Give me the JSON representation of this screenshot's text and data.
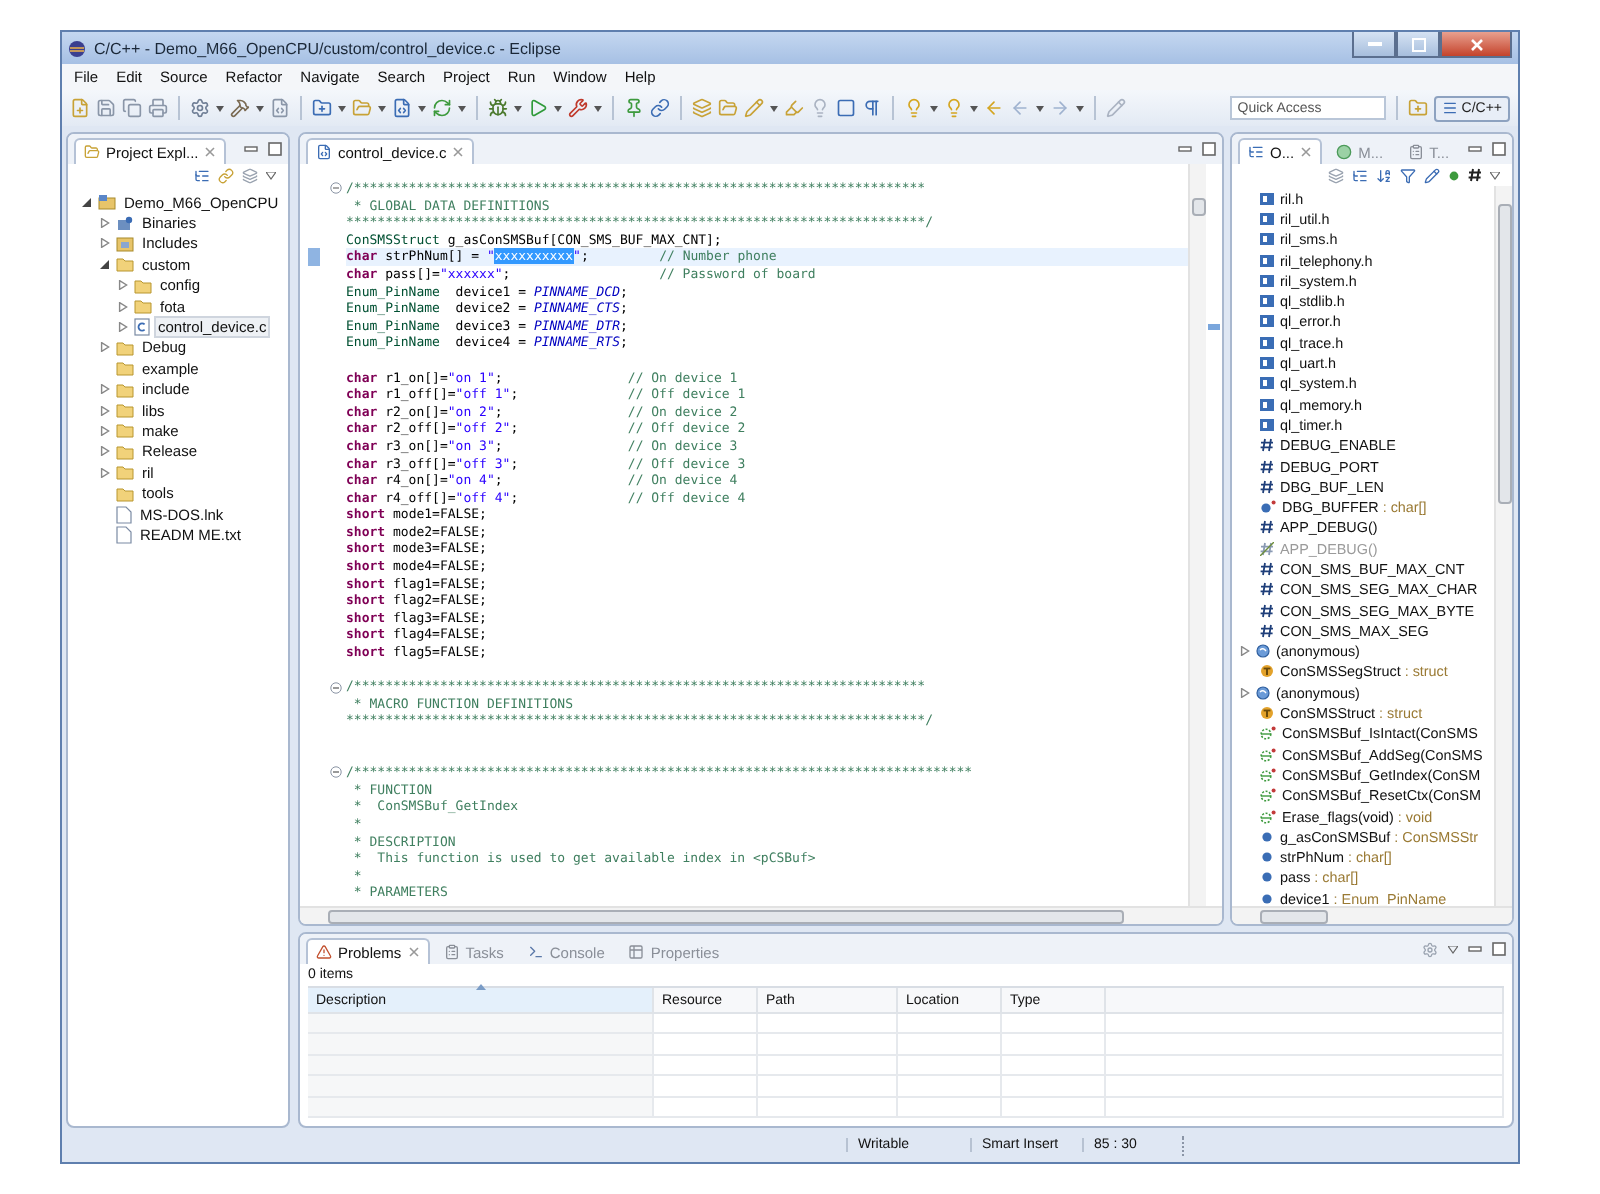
{
  "window": {
    "title": "C/C++ - Demo_M66_OpenCPU/custom/control_device.c - Eclipse"
  },
  "menu": [
    "File",
    "Edit",
    "Source",
    "Refactor",
    "Navigate",
    "Search",
    "Project",
    "Run",
    "Window",
    "Help"
  ],
  "quick_access": {
    "placeholder": "Quick Access"
  },
  "perspective": {
    "label": "C/C++",
    "selected": true
  },
  "explorer": {
    "tab": "Project Expl...",
    "tree": [
      {
        "label": "Demo_M66_OpenCPU",
        "kind": "project",
        "selected": false,
        "expanded": true,
        "children": [
          {
            "label": "Binaries",
            "kind": "binaries",
            "selected": false,
            "expanded": false
          },
          {
            "label": "Includes",
            "kind": "includes",
            "selected": false,
            "expanded": false
          },
          {
            "label": "custom",
            "kind": "folder",
            "selected": false,
            "expanded": true,
            "children": [
              {
                "label": "config",
                "kind": "folder",
                "selected": false,
                "expanded": false
              },
              {
                "label": "fota",
                "kind": "folder",
                "selected": false,
                "expanded": false
              },
              {
                "label": "control_device.c",
                "kind": "cfile",
                "selected": true,
                "expanded": false
              }
            ]
          },
          {
            "label": "Debug",
            "kind": "folder",
            "selected": false,
            "expanded": false
          },
          {
            "label": "example",
            "kind": "folder",
            "selected": false
          },
          {
            "label": "include",
            "kind": "folder",
            "selected": false,
            "expanded": false
          },
          {
            "label": "libs",
            "kind": "folder",
            "selected": false,
            "expanded": false
          },
          {
            "label": "make",
            "kind": "folder",
            "selected": false,
            "expanded": false
          },
          {
            "label": "Release",
            "kind": "folder",
            "selected": false,
            "expanded": false
          },
          {
            "label": "ril",
            "kind": "folder",
            "selected": false,
            "expanded": false
          },
          {
            "label": "tools",
            "kind": "folder",
            "selected": false
          },
          {
            "label": "MS-DOS.lnk",
            "kind": "file",
            "selected": false
          },
          {
            "label": "READM ME.txt",
            "kind": "file",
            "selected": false
          }
        ]
      }
    ]
  },
  "editor": {
    "tab": "control_device.c",
    "lines": [
      {
        "kind": "code",
        "current": false,
        "fold_open": true,
        "segments": [
          {
            "kind": "comment",
            "text": "/*************************************************************************"
          }
        ]
      },
      {
        "kind": "code",
        "current": false,
        "segments": [
          {
            "kind": "comment",
            "text": " * GLOBAL DATA DEFINITIONS"
          }
        ]
      },
      {
        "kind": "code",
        "current": false,
        "segments": [
          {
            "kind": "comment",
            "text": "**************************************************************************/"
          }
        ]
      },
      {
        "kind": "code",
        "current": false,
        "segments": [
          {
            "kind": "type",
            "text": "ConSMSStruct"
          },
          {
            "kind": "plain",
            "text": " g_asConSMSBuf[CON_SMS_BUF_MAX_CNT];"
          }
        ]
      },
      {
        "kind": "code",
        "current": true,
        "segments": [
          {
            "kind": "keyword",
            "text": "char"
          },
          {
            "kind": "plain",
            "text": " strPhNum[] = "
          },
          {
            "kind": "string",
            "text": "\""
          },
          {
            "kind": "selection",
            "text": "xxxxxxxxxx"
          },
          {
            "kind": "string",
            "text": "\""
          },
          {
            "kind": "plain",
            "text": ";         "
          },
          {
            "kind": "comment",
            "text": "// Number phone"
          }
        ]
      },
      {
        "kind": "code",
        "current": false,
        "segments": [
          {
            "kind": "keyword",
            "text": "char"
          },
          {
            "kind": "plain",
            "text": " pass[]="
          },
          {
            "kind": "string",
            "text": "\"xxxxxx\""
          },
          {
            "kind": "plain",
            "text": ";                   "
          },
          {
            "kind": "comment",
            "text": "// Password of board"
          }
        ]
      },
      {
        "kind": "code",
        "current": false,
        "segments": [
          {
            "kind": "type",
            "text": "Enum_PinName"
          },
          {
            "kind": "plain",
            "text": "  device1 = "
          },
          {
            "kind": "macro",
            "text": "PINNAME_DCD"
          },
          {
            "kind": "plain",
            "text": ";"
          }
        ]
      },
      {
        "kind": "code",
        "current": false,
        "segments": [
          {
            "kind": "type",
            "text": "Enum_PinName"
          },
          {
            "kind": "plain",
            "text": "  device2 = "
          },
          {
            "kind": "macro",
            "text": "PINNAME_CTS"
          },
          {
            "kind": "plain",
            "text": ";"
          }
        ]
      },
      {
        "kind": "code",
        "current": false,
        "segments": [
          {
            "kind": "type",
            "text": "Enum_PinName"
          },
          {
            "kind": "plain",
            "text": "  device3 = "
          },
          {
            "kind": "macro",
            "text": "PINNAME_DTR"
          },
          {
            "kind": "plain",
            "text": ";"
          }
        ]
      },
      {
        "kind": "code",
        "current": false,
        "segments": [
          {
            "kind": "type",
            "text": "Enum_PinName"
          },
          {
            "kind": "plain",
            "text": "  device4 = "
          },
          {
            "kind": "macro",
            "text": "PINNAME_RTS"
          },
          {
            "kind": "plain",
            "text": ";"
          }
        ]
      },
      {
        "kind": "blank",
        "current": false
      },
      {
        "kind": "code",
        "current": false,
        "segments": [
          {
            "kind": "keyword",
            "text": "char"
          },
          {
            "kind": "plain",
            "text": " r1_on[]="
          },
          {
            "kind": "string",
            "text": "\"on 1\""
          },
          {
            "kind": "plain",
            "text": ";                "
          },
          {
            "kind": "comment",
            "text": "// On device 1"
          }
        ]
      },
      {
        "kind": "code",
        "current": false,
        "segments": [
          {
            "kind": "keyword",
            "text": "char"
          },
          {
            "kind": "plain",
            "text": " r1_off[]="
          },
          {
            "kind": "string",
            "text": "\"off 1\""
          },
          {
            "kind": "plain",
            "text": ";              "
          },
          {
            "kind": "comment",
            "text": "// Off device 1"
          }
        ]
      },
      {
        "kind": "code",
        "current": false,
        "segments": [
          {
            "kind": "keyword",
            "text": "char"
          },
          {
            "kind": "plain",
            "text": " r2_on[]="
          },
          {
            "kind": "string",
            "text": "\"on 2\""
          },
          {
            "kind": "plain",
            "text": ";                "
          },
          {
            "kind": "comment",
            "text": "// On device 2"
          }
        ]
      },
      {
        "kind": "code",
        "current": false,
        "segments": [
          {
            "kind": "keyword",
            "text": "char"
          },
          {
            "kind": "plain",
            "text": " r2_off[]="
          },
          {
            "kind": "string",
            "text": "\"off 2\""
          },
          {
            "kind": "plain",
            "text": ";              "
          },
          {
            "kind": "comment",
            "text": "// Off device 2"
          }
        ]
      },
      {
        "kind": "code",
        "current": false,
        "segments": [
          {
            "kind": "keyword",
            "text": "char"
          },
          {
            "kind": "plain",
            "text": " r3_on[]="
          },
          {
            "kind": "string",
            "text": "\"on 3\""
          },
          {
            "kind": "plain",
            "text": ";                "
          },
          {
            "kind": "comment",
            "text": "// On device 3"
          }
        ]
      },
      {
        "kind": "code",
        "current": false,
        "segments": [
          {
            "kind": "keyword",
            "text": "char"
          },
          {
            "kind": "plain",
            "text": " r3_off[]="
          },
          {
            "kind": "string",
            "text": "\"off 3\""
          },
          {
            "kind": "plain",
            "text": ";              "
          },
          {
            "kind": "comment",
            "text": "// Off device 3"
          }
        ]
      },
      {
        "kind": "code",
        "current": false,
        "segments": [
          {
            "kind": "keyword",
            "text": "char"
          },
          {
            "kind": "plain",
            "text": " r4_on[]="
          },
          {
            "kind": "string",
            "text": "\"on 4\""
          },
          {
            "kind": "plain",
            "text": ";                "
          },
          {
            "kind": "comment",
            "text": "// On device 4"
          }
        ]
      },
      {
        "kind": "code",
        "current": false,
        "segments": [
          {
            "kind": "keyword",
            "text": "char"
          },
          {
            "kind": "plain",
            "text": " r4_off[]="
          },
          {
            "kind": "string",
            "text": "\"off 4\""
          },
          {
            "kind": "plain",
            "text": ";              "
          },
          {
            "kind": "comment",
            "text": "// Off device 4"
          }
        ]
      },
      {
        "kind": "code",
        "current": false,
        "segments": [
          {
            "kind": "keyword",
            "text": "short"
          },
          {
            "kind": "plain",
            "text": " mode1=FALSE;"
          }
        ]
      },
      {
        "kind": "code",
        "current": false,
        "segments": [
          {
            "kind": "keyword",
            "text": "short"
          },
          {
            "kind": "plain",
            "text": " mode2=FALSE;"
          }
        ]
      },
      {
        "kind": "code",
        "current": false,
        "segments": [
          {
            "kind": "keyword",
            "text": "short"
          },
          {
            "kind": "plain",
            "text": " mode3=FALSE;"
          }
        ]
      },
      {
        "kind": "code",
        "current": false,
        "segments": [
          {
            "kind": "keyword",
            "text": "short"
          },
          {
            "kind": "plain",
            "text": " mode4=FALSE;"
          }
        ]
      },
      {
        "kind": "code",
        "current": false,
        "segments": [
          {
            "kind": "keyword",
            "text": "short"
          },
          {
            "kind": "plain",
            "text": " flag1=FALSE;"
          }
        ]
      },
      {
        "kind": "code",
        "current": false,
        "segments": [
          {
            "kind": "keyword",
            "text": "short"
          },
          {
            "kind": "plain",
            "text": " flag2=FALSE;"
          }
        ]
      },
      {
        "kind": "code",
        "current": false,
        "segments": [
          {
            "kind": "keyword",
            "text": "short"
          },
          {
            "kind": "plain",
            "text": " flag3=FALSE;"
          }
        ]
      },
      {
        "kind": "code",
        "current": false,
        "segments": [
          {
            "kind": "keyword",
            "text": "short"
          },
          {
            "kind": "plain",
            "text": " flag4=FALSE;"
          }
        ]
      },
      {
        "kind": "code",
        "current": false,
        "segments": [
          {
            "kind": "keyword",
            "text": "short"
          },
          {
            "kind": "plain",
            "text": " flag5=FALSE;"
          }
        ]
      },
      {
        "kind": "blank",
        "current": false
      },
      {
        "kind": "code",
        "current": false,
        "fold_open": true,
        "segments": [
          {
            "kind": "comment",
            "text": "/*************************************************************************"
          }
        ]
      },
      {
        "kind": "code",
        "current": false,
        "segments": [
          {
            "kind": "comment",
            "text": " * MACRO FUNCTION DEFINITIONS"
          }
        ]
      },
      {
        "kind": "code",
        "current": false,
        "segments": [
          {
            "kind": "comment",
            "text": "**************************************************************************/"
          }
        ]
      },
      {
        "kind": "blank",
        "current": false
      },
      {
        "kind": "blank",
        "current": false
      },
      {
        "kind": "code",
        "current": false,
        "fold_open": true,
        "segments": [
          {
            "kind": "comment",
            "text": "/*******************************************************************************"
          }
        ]
      },
      {
        "kind": "code",
        "current": false,
        "segments": [
          {
            "kind": "comment",
            "text": " * FUNCTION"
          }
        ]
      },
      {
        "kind": "code",
        "current": false,
        "segments": [
          {
            "kind": "comment",
            "text": " *  ConSMSBuf_GetIndex"
          }
        ]
      },
      {
        "kind": "code",
        "current": false,
        "segments": [
          {
            "kind": "comment",
            "text": " *"
          }
        ]
      },
      {
        "kind": "code",
        "current": false,
        "segments": [
          {
            "kind": "comment",
            "text": " * DESCRIPTION"
          }
        ]
      },
      {
        "kind": "code",
        "current": false,
        "segments": [
          {
            "kind": "comment",
            "text": " *  This function is used to get available index in <pCSBuf>"
          }
        ]
      },
      {
        "kind": "code",
        "current": false,
        "segments": [
          {
            "kind": "comment",
            "text": " *"
          }
        ]
      },
      {
        "kind": "code",
        "current": false,
        "segments": [
          {
            "kind": "comment",
            "text": " * PARAMETERS"
          }
        ]
      }
    ]
  },
  "outline": {
    "tabs": [
      {
        "label": "O...",
        "kind": "outline",
        "selected": true
      },
      {
        "label": "M...",
        "kind": "make",
        "selected": false
      },
      {
        "label": "T...",
        "kind": "tasks",
        "selected": false
      }
    ],
    "items": [
      {
        "kind": "include",
        "label": "ril.h"
      },
      {
        "kind": "include",
        "label": "ril_util.h"
      },
      {
        "kind": "include",
        "label": "ril_sms.h"
      },
      {
        "kind": "include",
        "label": "ril_telephony.h"
      },
      {
        "kind": "include",
        "label": "ril_system.h"
      },
      {
        "kind": "include",
        "label": "ql_stdlib.h"
      },
      {
        "kind": "include",
        "label": "ql_error.h"
      },
      {
        "kind": "include",
        "label": "ql_trace.h"
      },
      {
        "kind": "include",
        "label": "ql_uart.h"
      },
      {
        "kind": "include",
        "label": "ql_system.h"
      },
      {
        "kind": "include",
        "label": "ql_memory.h"
      },
      {
        "kind": "include",
        "label": "ql_timer.h"
      },
      {
        "kind": "macro",
        "label": "DEBUG_ENABLE"
      },
      {
        "kind": "macro",
        "label": "DEBUG_PORT"
      },
      {
        "kind": "macro",
        "label": "DBG_BUF_LEN"
      },
      {
        "kind": "static-variable",
        "label": "DBG_BUFFER",
        "type": ": char[]"
      },
      {
        "kind": "macro",
        "label": "APP_DEBUG()"
      },
      {
        "kind": "macro-inactive",
        "label": "APP_DEBUG()"
      },
      {
        "kind": "macro",
        "label": "CON_SMS_BUF_MAX_CNT"
      },
      {
        "kind": "macro",
        "label": "CON_SMS_SEG_MAX_CHAR"
      },
      {
        "kind": "macro",
        "label": "CON_SMS_SEG_MAX_BYTE"
      },
      {
        "kind": "macro",
        "label": "CON_SMS_MAX_SEG"
      },
      {
        "kind": "struct",
        "label": "(anonymous)",
        "expanded": false
      },
      {
        "kind": "typedef",
        "label": "ConSMSSegStruct",
        "type": ": struct"
      },
      {
        "kind": "struct",
        "label": "(anonymous)",
        "expanded": false
      },
      {
        "kind": "typedef",
        "label": "ConSMSStruct",
        "type": ": struct"
      },
      {
        "kind": "static-function",
        "label": "ConSMSBuf_IsIntact(ConSMS"
      },
      {
        "kind": "static-function",
        "label": "ConSMSBuf_AddSeg(ConSMS"
      },
      {
        "kind": "static-function",
        "label": "ConSMSBuf_GetIndex(ConSM"
      },
      {
        "kind": "static-function",
        "label": "ConSMSBuf_ResetCtx(ConSM"
      },
      {
        "kind": "static-function",
        "label": "Erase_flags(void)",
        "type": ": void"
      },
      {
        "kind": "variable",
        "label": "g_asConSMSBuf",
        "type": ": ConSMSStr"
      },
      {
        "kind": "variable",
        "label": "strPhNum",
        "type": ": char[]"
      },
      {
        "kind": "variable",
        "label": "pass",
        "type": ": char[]"
      },
      {
        "kind": "variable",
        "label": "device1",
        "type": ": Enum_PinName"
      }
    ]
  },
  "problems": {
    "tabs": [
      {
        "label": "Problems",
        "kind": "problems",
        "selected": true
      },
      {
        "label": "Tasks",
        "kind": "tasks",
        "selected": false
      },
      {
        "label": "Console",
        "kind": "console",
        "selected": false
      },
      {
        "label": "Properties",
        "kind": "properties",
        "selected": false
      }
    ],
    "summary": "0 items",
    "columns": [
      "Description",
      "Resource",
      "Path",
      "Location",
      "Type"
    ]
  },
  "status_bar": [
    "Writable",
    "Smart Insert",
    "85 : 30"
  ]
}
